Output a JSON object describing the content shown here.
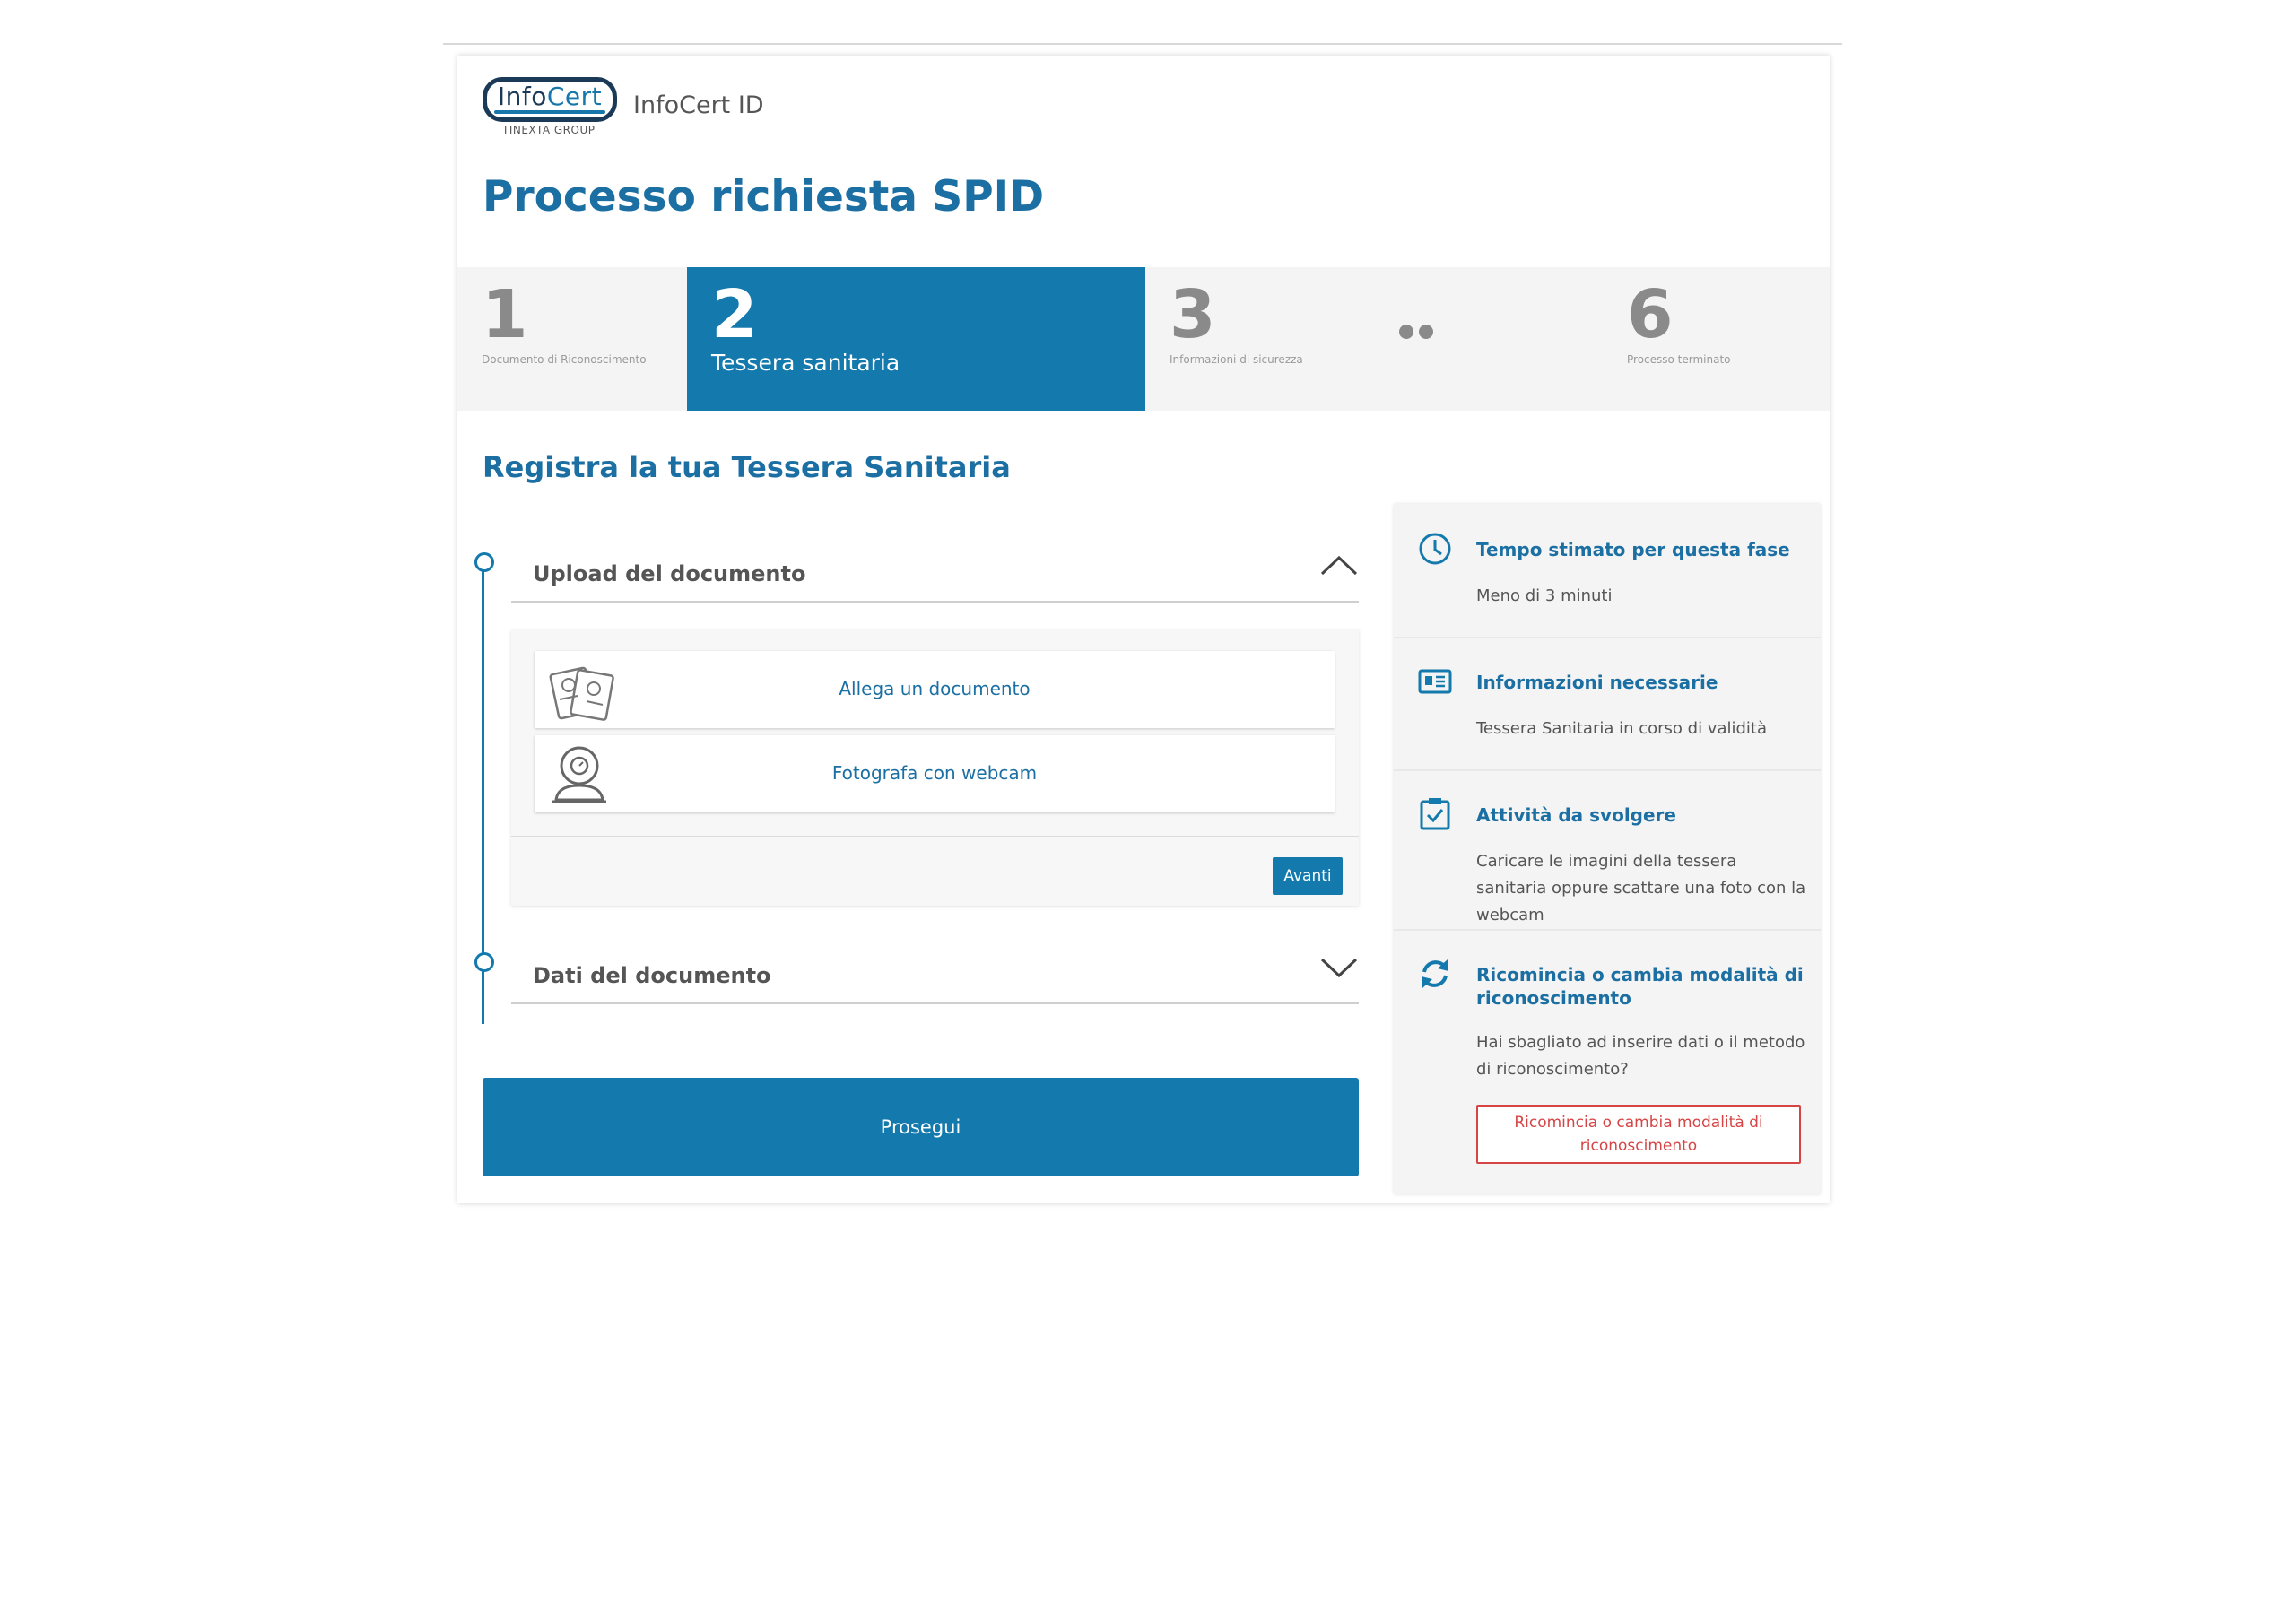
{
  "header": {
    "logo_text_a": "Info",
    "logo_text_b": "Cert",
    "logo_sub": "TINEXTA GROUP",
    "app_name": "InfoCert ID",
    "page_title": "Processo richiesta SPID"
  },
  "stepper": {
    "steps": [
      {
        "number": "1",
        "label": "Documento di Riconoscimento",
        "active": false
      },
      {
        "number": "2",
        "label": "Tessera sanitaria",
        "active": true
      },
      {
        "number": "3",
        "label": "Informazioni di sicurezza",
        "active": false
      },
      {
        "number": "6",
        "label": "Processo terminato",
        "active": false
      }
    ]
  },
  "main": {
    "section_title": "Registra la tua Tessera Sanitaria",
    "upload": {
      "title": "Upload del documento",
      "expanded": true,
      "options": [
        {
          "label": "Allega un documento",
          "icon": "document-icon"
        },
        {
          "label": "Fotografa con webcam",
          "icon": "webcam-icon"
        }
      ],
      "next_label": "Avanti"
    },
    "data_section": {
      "title": "Dati del documento",
      "expanded": false
    },
    "continue_label": "Prosegui"
  },
  "side": {
    "items": [
      {
        "icon": "clock-icon",
        "title": "Tempo stimato per questa fase",
        "text": "Meno di 3 minuti"
      },
      {
        "icon": "id-card-icon",
        "title": "Informazioni necessarie",
        "text": "Tessera Sanitaria in corso di validità"
      },
      {
        "icon": "checklist-icon",
        "title": "Attività da svolgere",
        "text": "Caricare le imagini della tessera sanitaria oppure scattare una foto con la webcam"
      },
      {
        "icon": "refresh-icon",
        "title": "Ricomincia o cambia modalità di riconoscimento",
        "text": "Hai sbagliato ad inserire dati o il metodo di riconoscimento?",
        "button_label": "Ricomincia o cambia modalità di riconoscimento"
      }
    ]
  },
  "colors": {
    "primary": "#1479ad",
    "title": "#1b6fa3",
    "danger": "#d64545"
  }
}
